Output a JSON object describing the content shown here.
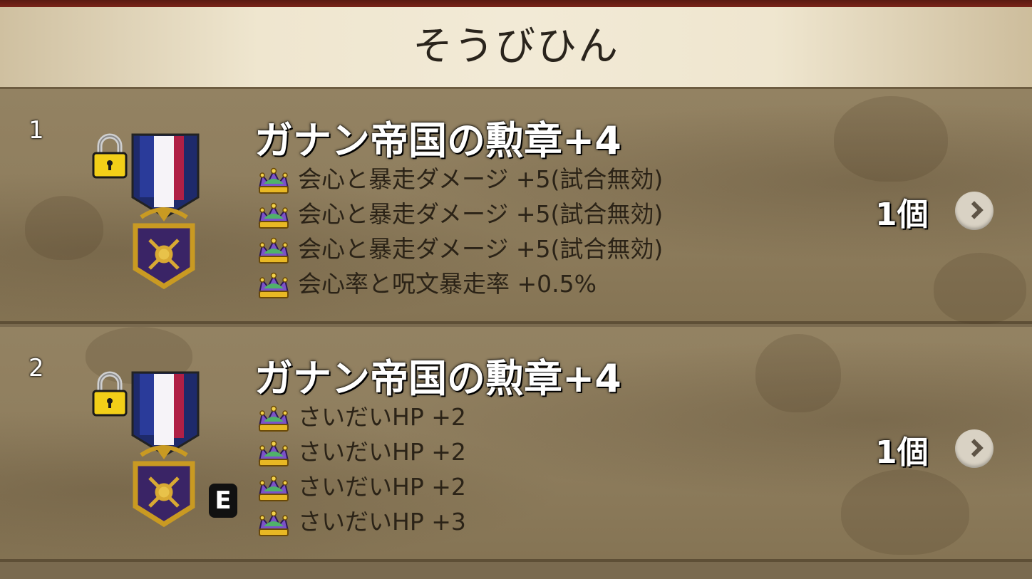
{
  "header": {
    "title": "そうびひん"
  },
  "items": [
    {
      "index": "1",
      "name": "ガナン帝国の勲章+4",
      "quantity": "1個",
      "locked": true,
      "equipped": false,
      "stats": [
        "会心と暴走ダメージ  +5(試合無効)",
        "会心と暴走ダメージ  +5(試合無効)",
        "会心と暴走ダメージ  +5(試合無効)",
        "会心率と呪文暴走率  +0.5%"
      ]
    },
    {
      "index": "2",
      "name": "ガナン帝国の勲章+4",
      "quantity": "1個",
      "locked": true,
      "equipped": true,
      "equipped_badge": "E",
      "stats": [
        "さいだいHP  +2",
        "さいだいHP  +2",
        "さいだいHP  +2",
        "さいだいHP  +3"
      ]
    }
  ],
  "colors": {
    "header_bg": "#efe6cf",
    "row_bg": "#8f7e5e",
    "top_bar": "#6a1f15",
    "stat_text": "#2b2317"
  },
  "icons": {
    "medal": "medal-icon",
    "lock": "padlock-icon",
    "stat": "crown-icon",
    "detail": "chevron-right-icon"
  }
}
